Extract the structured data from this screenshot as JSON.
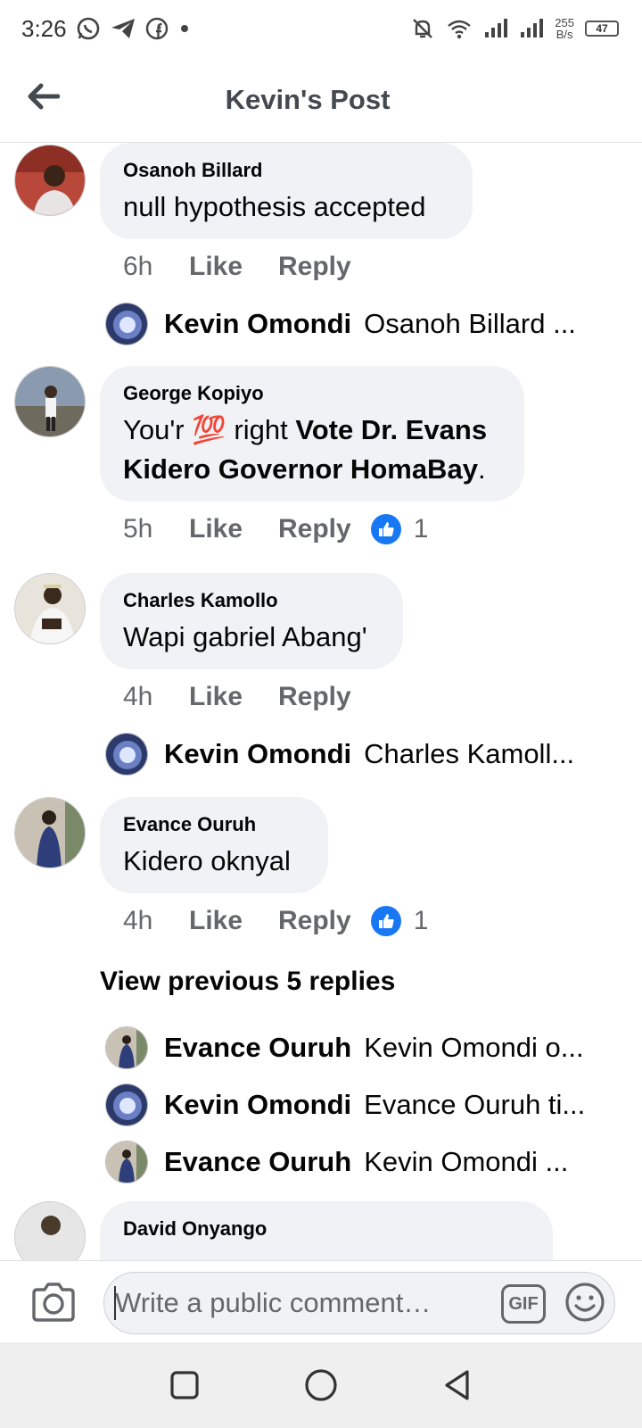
{
  "status_bar": {
    "time": "3:26",
    "net_speed_value": "255",
    "net_speed_unit": "B/s",
    "battery": "47",
    "icons": [
      "whatsapp-icon",
      "telegram-icon",
      "facebook-icon",
      "dot-icon",
      "bell-off-icon",
      "wifi-icon",
      "signal-icon",
      "signal-icon",
      "battery-icon"
    ]
  },
  "header": {
    "title": "Kevin's Post",
    "back_icon": "arrow-left-icon"
  },
  "comments": [
    {
      "author": "Osanoh Billard",
      "text_parts": [
        {
          "t": "null hypothesis accepted",
          "bold": false
        }
      ],
      "time": "6h",
      "like": "Like",
      "reply": "Reply",
      "reaction_count": null,
      "replies": [
        {
          "name": "Kevin Omondi",
          "snippet": "Osanoh Billard ..."
        }
      ]
    },
    {
      "author": "George Kopiyo",
      "text_parts": [
        {
          "t": "You'r ",
          "bold": false
        },
        {
          "t": "💯",
          "bold": false
        },
        {
          "t": " right ",
          "bold": false
        },
        {
          "t": "Vote Dr. Evans Kidero Governor HomaBay",
          "bold": true
        },
        {
          "t": ".",
          "bold": false
        }
      ],
      "time": "5h",
      "like": "Like",
      "reply": "Reply",
      "reaction_count": "1",
      "replies": []
    },
    {
      "author": "Charles Kamollo",
      "text_parts": [
        {
          "t": "Wapi gabriel Abang'",
          "bold": false
        }
      ],
      "time": "4h",
      "like": "Like",
      "reply": "Reply",
      "reaction_count": null,
      "replies": [
        {
          "name": "Kevin Omondi",
          "snippet": "Charles Kamoll..."
        }
      ]
    },
    {
      "author": "Evance Ouruh",
      "text_parts": [
        {
          "t": "Kidero oknyal",
          "bold": false
        }
      ],
      "time": "4h",
      "like": "Like",
      "reply": "Reply",
      "reaction_count": "1",
      "view_previous": "View previous 5 replies",
      "replies": [
        {
          "name": "Evance Ouruh",
          "snippet": "Kevin Omondi o..."
        },
        {
          "name": "Kevin Omondi",
          "snippet": "Evance Ouruh ti..."
        },
        {
          "name": "Evance Ouruh",
          "snippet": "Kevin Omondi ..."
        }
      ]
    },
    {
      "author": "David Onyango",
      "text_parts": [],
      "time": "",
      "like": "",
      "reply": "",
      "reaction_count": null,
      "replies": []
    }
  ],
  "composer": {
    "placeholder": "Write a public comment…",
    "gif_label": "GIF",
    "camera_icon": "camera-icon",
    "emoji_icon": "emoji-icon"
  },
  "nav": {
    "icons": [
      "recents-square-icon",
      "home-circle-icon",
      "back-triangle-icon"
    ]
  },
  "colors": {
    "bubble": "#f0f2f5",
    "secondary_text": "#65676b",
    "like_blue": "#1877f2"
  }
}
